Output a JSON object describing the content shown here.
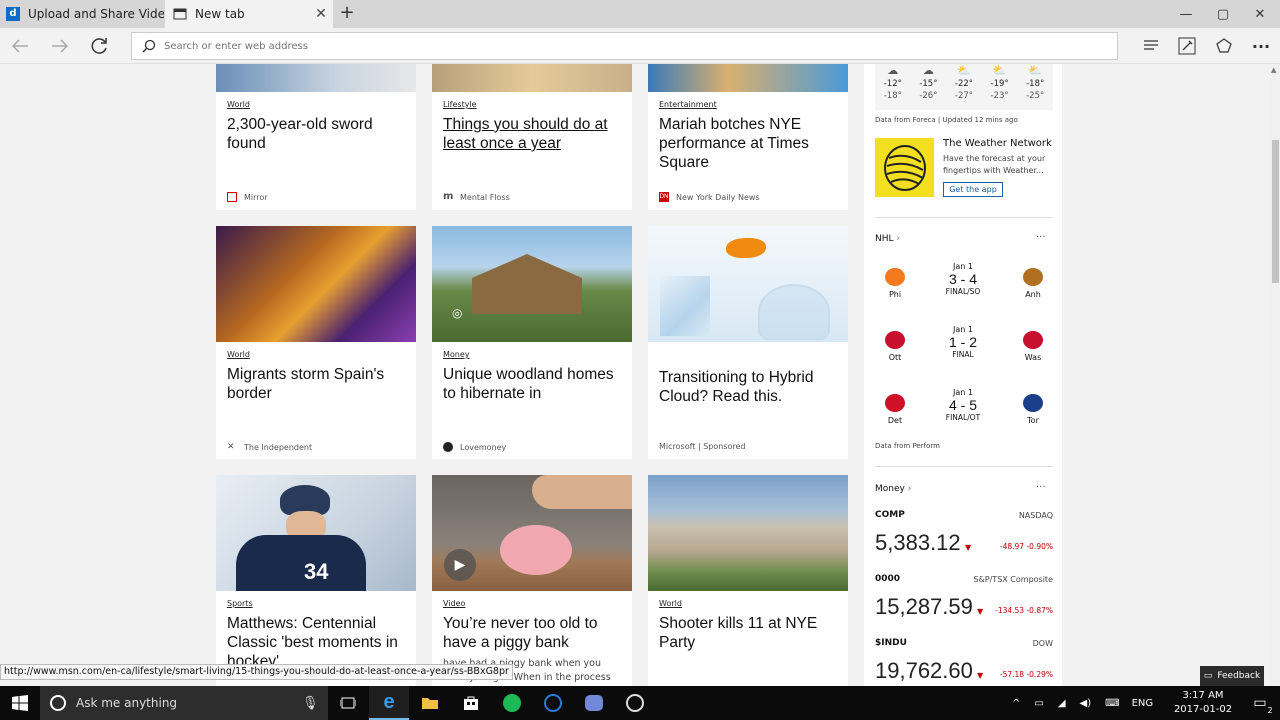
{
  "browser": {
    "tabs": [
      {
        "title": "Upload and Share Videos | I"
      },
      {
        "title": "New tab"
      }
    ],
    "address_placeholder": "Search or enter web address"
  },
  "cards": [
    {
      "category": "World",
      "title": "2,300-year-old sword found",
      "source": "Mirror"
    },
    {
      "category": "Lifestyle",
      "title": "Things you should do at least once a year",
      "source": "Mental Floss"
    },
    {
      "category": "Entertainment",
      "title": "Mariah botches NYE performance at Times Square",
      "source": "New York Daily News"
    },
    {
      "category": "World",
      "title": "Migrants storm Spain's border",
      "source": "The Independent"
    },
    {
      "category": "Money",
      "title": "Unique woodland homes to hibernate in",
      "source": "Lovemoney"
    },
    {
      "category": "",
      "title": "Transitioning to Hybrid Cloud? Read this.",
      "source": "Microsoft | Sponsored"
    },
    {
      "category": "Sports",
      "title": "Matthews: Centennial Classic 'best moments in hockey'",
      "source": ""
    },
    {
      "category": "Video",
      "title": "You’re never too old to have a piggy bank",
      "snippet": "have had a piggy bank when you were younger. When in the process",
      "source": ""
    },
    {
      "category": "World",
      "title": "Shooter kills 11 at NYE Party",
      "source": ""
    }
  ],
  "weather": {
    "days": [
      {
        "high": "-12°",
        "low": "-18°"
      },
      {
        "high": "-15°",
        "low": "-26°"
      },
      {
        "high": "-22°",
        "low": "-27°"
      },
      {
        "high": "-19°",
        "low": "-23°"
      },
      {
        "high": "-18°",
        "low": "-25°"
      }
    ],
    "credit": "Data from Foreca | Updated 12 mins ago",
    "ad_title": "The Weather Network",
    "ad_desc": "Have the forecast at your fingertips with Weather...",
    "ad_button": "Get the app"
  },
  "nhl": {
    "heading": "NHL",
    "more": "···",
    "games": [
      {
        "date": "Jan 1",
        "score": "3 - 4",
        "status": "FINAL/SO",
        "home": "Phi",
        "away": "Anh"
      },
      {
        "date": "Jan 1",
        "score": "1 - 2",
        "status": "FINAL",
        "home": "Ott",
        "away": "Was"
      },
      {
        "date": "Jan 1",
        "score": "4 - 5",
        "status": "FINAL/OT",
        "home": "Det",
        "away": "Tor"
      }
    ],
    "credit": "Data from Perform"
  },
  "money": {
    "heading": "Money",
    "more": "···",
    "stocks": [
      {
        "symbol": "COMP",
        "exchange": "NASDAQ",
        "value": "5,383.12",
        "change": "-48.97",
        "pct": "-0.90%"
      },
      {
        "symbol": "0000",
        "exchange": "S&P/TSX Composite",
        "value": "15,287.59",
        "change": "-134.53",
        "pct": "-0.87%"
      },
      {
        "symbol": "$INDU",
        "exchange": "DOW",
        "value": "19,762.60",
        "change": "-57.18",
        "pct": "-0.29%"
      }
    ]
  },
  "status_url": "http://www.msn.com/en-ca/lifestyle/smart-living/15-things-you-should-do-at-least-once-a-year/ss-BBxG8pr",
  "feedback": "Feedback",
  "taskbar": {
    "search_placeholder": "Ask me anything",
    "time": "3:17 AM",
    "date": "2017-01-02",
    "lang": "ENG",
    "notif_count": "2"
  }
}
